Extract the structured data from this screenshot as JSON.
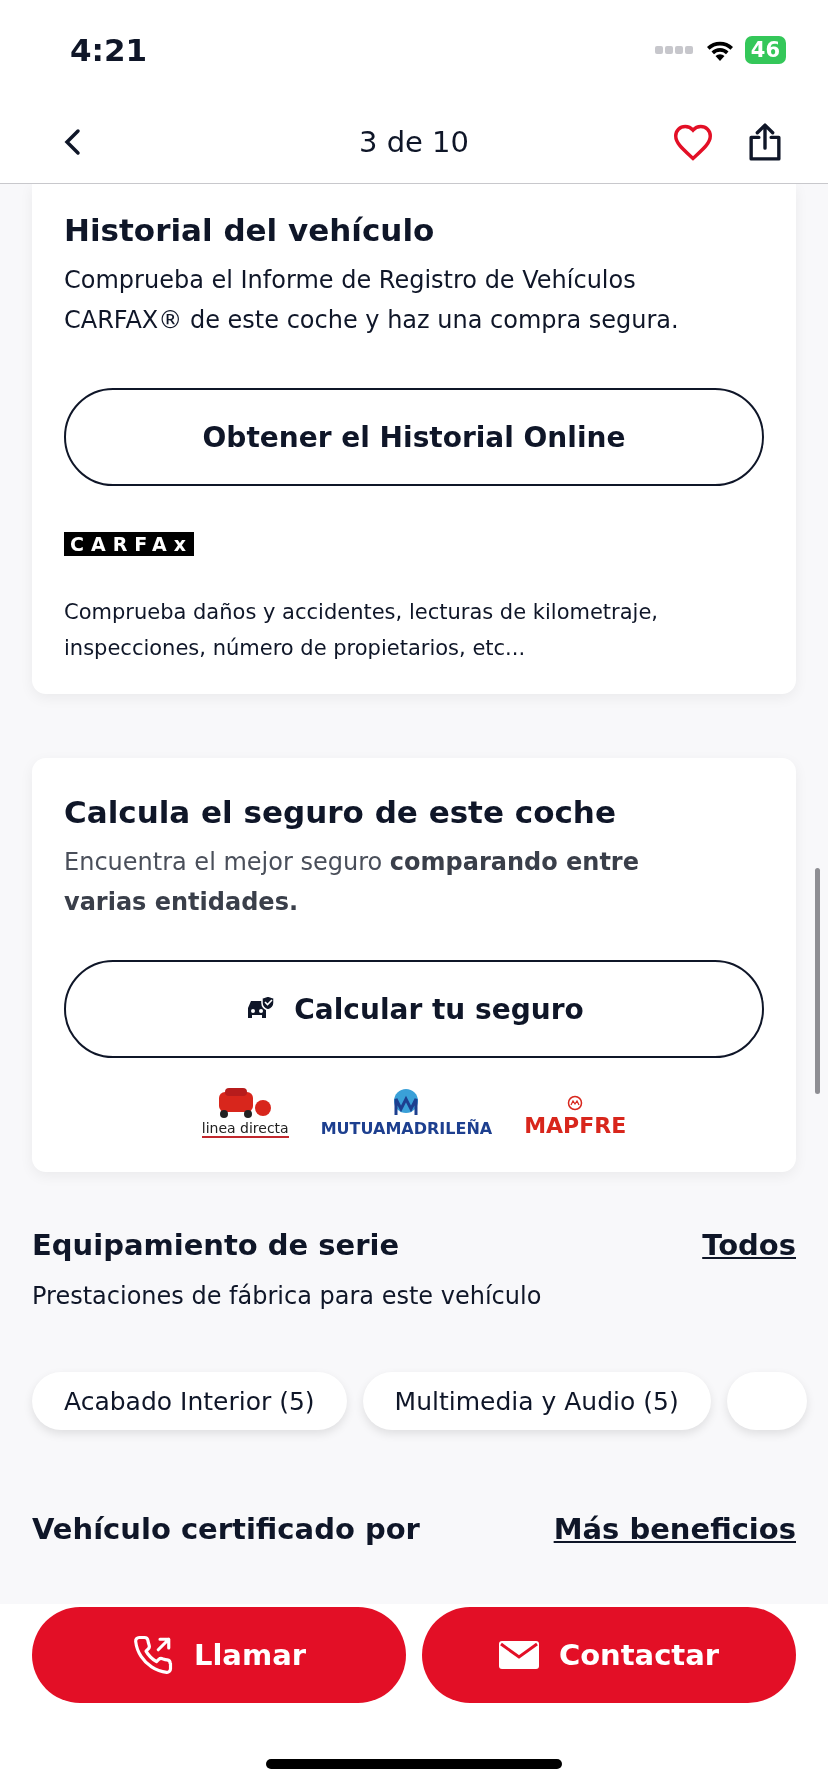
{
  "status_bar": {
    "time": "4:21",
    "battery": "46"
  },
  "nav": {
    "title": "3 de 10",
    "favorite": false
  },
  "history_card": {
    "title": "Historial del vehículo",
    "description": "Comprueba el Informe de Registro de Vehículos CARFAX® de este coche y haz una compra segura.",
    "button": "Obtener el Historial Online",
    "logo": "CARFAx",
    "note": "Comprueba daños y accidentes, lecturas de kilometraje, inspecciones, número de propietarios, etc..."
  },
  "insurance_card": {
    "title": "Calcula el seguro de este coche",
    "description": "Encuentra el mejor seguro **comparando entre varias entidades.**",
    "button": "Calcular tu seguro",
    "insurers": [
      {
        "kind": "phone",
        "name": "linea directa",
        "color": "#222222"
      },
      {
        "kind": "monogram",
        "name": "MUTUAMADRILEÑA",
        "color": "#1d3f8f"
      },
      {
        "kind": "ring",
        "name": "MAPFRE",
        "color": "#d8261c"
      }
    ]
  },
  "equipment": {
    "title": "Equipamiento de serie",
    "link": "Todos",
    "subtitle": "Prestaciones de fábrica para este vehículo",
    "chips": [
      {
        "label": "Acabado Interior (5)"
      },
      {
        "label": "Multimedia y Audio (5)"
      }
    ]
  },
  "certified": {
    "title": "Vehículo certificado por",
    "link": "Más beneficios"
  },
  "actions": [
    {
      "kind": "call",
      "label": "Llamar"
    },
    {
      "kind": "contact",
      "label": "Contactar"
    }
  ]
}
